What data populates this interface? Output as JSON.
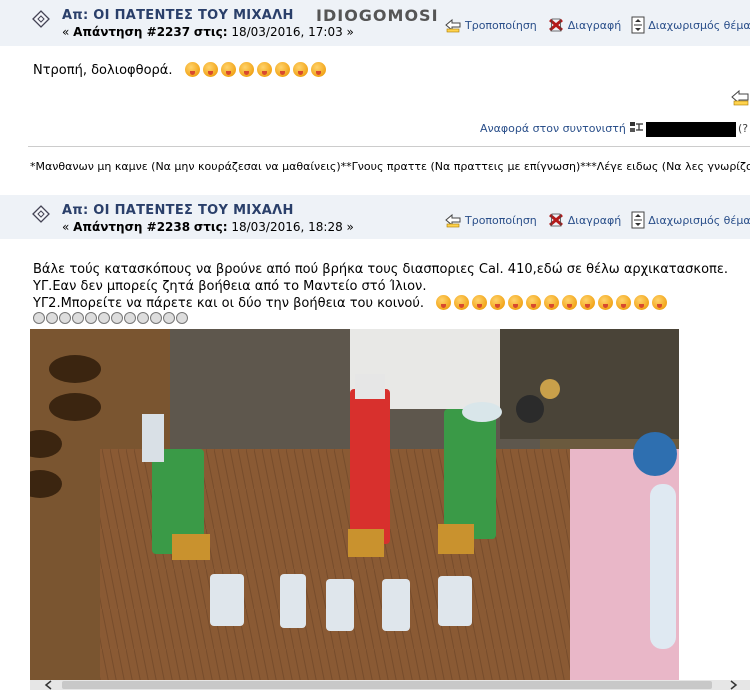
{
  "posts": [
    {
      "subject": "Απ: ΟΙ ΠΑΤΕΝΤΕΣ ΤΟΥ ΜΙΧΑΛΗ",
      "reply_prefix": "«",
      "reply_label": "Απάντηση #2237",
      "on_label": "στις:",
      "date": "18/03/2016, 17:03",
      "reply_suffix": "»",
      "watermark": "IDIOGOMOSI",
      "buttons": {
        "edit": "Τροποποίηση",
        "delete": "Διαγραφή",
        "split": "Διαχωρισμός θέματος"
      },
      "body_lines": [
        "Ντροπή, δολιοφθορά."
      ],
      "emoticon_count": 8,
      "report_label": "Αναφορά στον συντονιστή",
      "ip_suffix": "(?",
      "signature": "*Μανθανων μη καμνε (Να μην κουράζεσαι να μαθαίνεις)**Γνους πραττε (Να πραττεις με επίγνωση)***Λέγε ειδως (Να λες γνωρίζοντας"
    },
    {
      "subject": "Απ: ΟΙ ΠΑΤΕΝΤΕΣ ΤΟΥ ΜΙΧΑΛΗ",
      "reply_prefix": "«",
      "reply_label": "Απάντηση #2238",
      "on_label": "στις:",
      "date": "18/03/2016, 18:28",
      "reply_suffix": "»",
      "buttons": {
        "edit": "Τροποποίηση",
        "delete": "Διαγραφή",
        "split": "Διαχωρισμός θέματος"
      },
      "body_lines": [
        "Βάλε τούς κατασκόπους να βρούνε από πού βρήκα τους διασποριες Cal. 410,εδώ σε θέλω αρχικατασκοπε.",
        "ΥΓ.Εαν δεν μπορείς ζητά βοήθεια από το Μαντείο στό Ίλιον.",
        "ΥΓ2.Μπορείτε να πάρετε και οι δύο την βοήθεια του κοινού."
      ],
      "emoticon_count": 13,
      "small_emoticon_count": 12
    }
  ],
  "colors": {
    "header_bg": "#eef2f7",
    "subject": "#2a3f6a",
    "link": "#2a4f8a"
  }
}
